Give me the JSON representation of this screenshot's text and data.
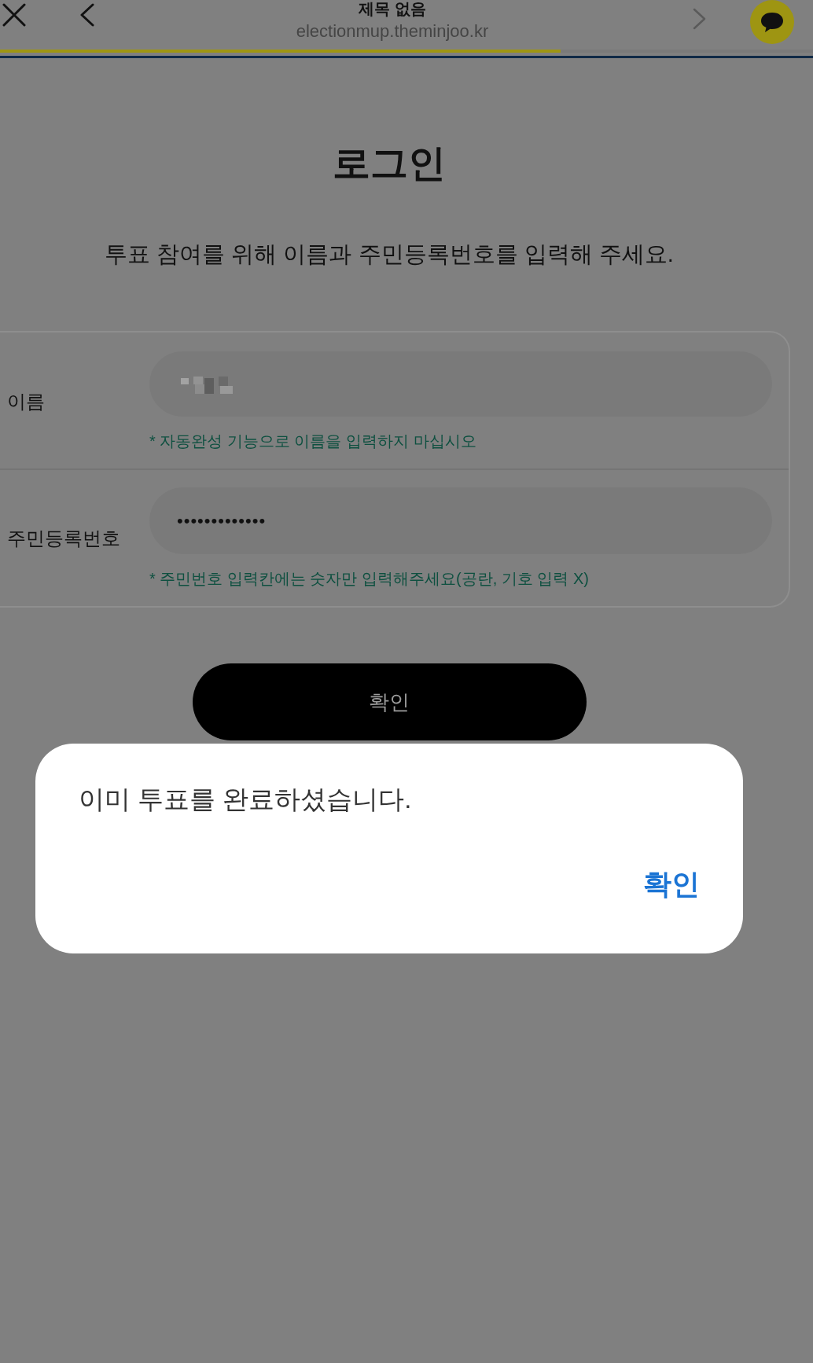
{
  "browser_bar": {
    "nav_buttons": [
      {
        "kind": "close",
        "disabled": false
      },
      {
        "kind": "back",
        "disabled": false
      },
      {
        "kind": "forward",
        "disabled": true
      }
    ],
    "title": "제목 없음",
    "url": "electionmup.theminjoo.kr",
    "load_progress": {
      "level": 0.69
    }
  },
  "page": {
    "heading": "로그인",
    "instruction": "투표 참여를 위해 이름과 주민등록번호를 입력해 주세요.",
    "form": {
      "rows": [
        {
          "kind": "redacted",
          "label": "이름",
          "hint": "* 자동완성 기능으로 이름을 입력하지 마십시오"
        },
        {
          "kind": "masked",
          "label": "주민등록번호",
          "value": "•••••••••••••",
          "hint": "* 주민번호 입력칸에는 숫자만 입력해주세요(공란, 기호 입력 X)"
        }
      ]
    },
    "submit_button": "확인"
  },
  "dialog": {
    "message": "이미 투표를 완료하셨습니다.",
    "button": "확인"
  }
}
